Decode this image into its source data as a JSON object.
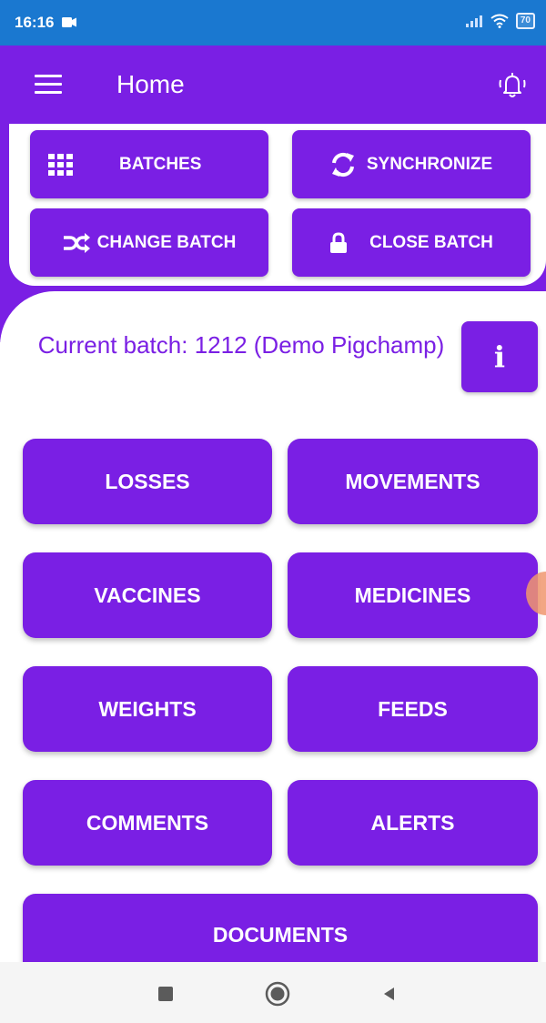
{
  "status_bar": {
    "time": "16:16",
    "battery": "70"
  },
  "app_bar": {
    "title": "Home",
    "menu_icon": "hamburger-menu-icon",
    "alarm_icon": "alarm-bell-icon"
  },
  "toolbar": {
    "batches": {
      "label": "BATCHES",
      "icon": "grid-icon"
    },
    "synchronize": {
      "label": "SYNCHRONIZE",
      "icon": "sync-icon"
    },
    "change_batch": {
      "label": "CHANGE BATCH",
      "icon": "shuffle-icon"
    },
    "close_batch": {
      "label": "CLOSE BATCH",
      "icon": "lock-icon"
    }
  },
  "current_batch": {
    "text": "Current batch: 1212 (Demo Pigchamp)",
    "info_label": "i"
  },
  "menu": {
    "losses": "LOSSES",
    "movements": "MOVEMENTS",
    "vaccines": "VACCINES",
    "medicines": "MEDICINES",
    "weights": "WEIGHTS",
    "feeds": "FEEDS",
    "comments": "COMMENTS",
    "alerts": "ALERTS",
    "documents": "DOCUMENTS"
  },
  "nav_bar": {
    "recents_icon": "square-icon",
    "home_icon": "circle-icon",
    "back_icon": "triangle-back-icon"
  },
  "colors": {
    "primary": "#7a1fe4",
    "status_bar": "#1a78d0",
    "background": "#ffffff",
    "nav_bar": "#f5f5f5"
  }
}
